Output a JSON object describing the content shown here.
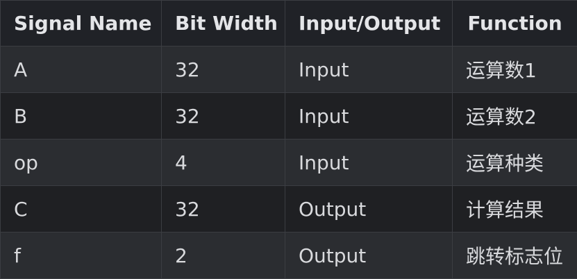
{
  "table": {
    "headers": [
      "Signal Name",
      "Bit Width",
      "Input/Output",
      "Function"
    ],
    "rows": [
      {
        "signal": "A",
        "width": "32",
        "io": "Input",
        "function": "运算数1"
      },
      {
        "signal": "B",
        "width": "32",
        "io": "Input",
        "function": "运算数2"
      },
      {
        "signal": "op",
        "width": "4",
        "io": "Input",
        "function": "运算种类"
      },
      {
        "signal": "C",
        "width": "32",
        "io": "Output",
        "function": "计算结果"
      },
      {
        "signal": "f",
        "width": "2",
        "io": "Output",
        "function": "跳转标志位"
      }
    ]
  }
}
